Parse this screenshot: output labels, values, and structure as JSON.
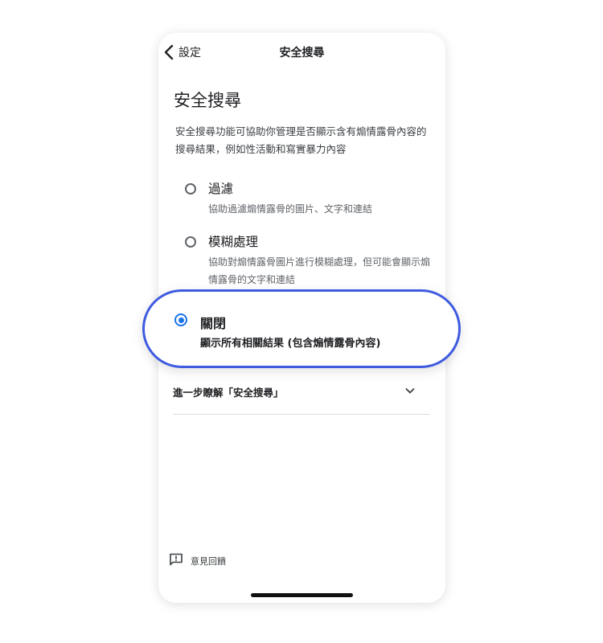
{
  "header": {
    "back_label": "設定",
    "title": "安全搜尋"
  },
  "page": {
    "title": "安全搜尋",
    "description": "安全搜尋功能可協助你管理是否顯示含有煽情露骨內容的搜尋結果，例如性活動和寫實暴力內容"
  },
  "options": [
    {
      "label": "過濾",
      "description": "協助過濾煽情露骨的圖片、文字和連結",
      "selected": false
    },
    {
      "label": "模糊處理",
      "description": "協助對煽情露骨圖片進行模糊處理，但可能會顯示煽情露骨的文字和連結",
      "selected": false
    },
    {
      "label": "關閉",
      "description": "顯示所有相關結果 (包含煽情露骨內容)",
      "selected": true
    }
  ],
  "learn_more": {
    "label": "進一步瞭解「安全搜尋」",
    "icon": "chevron-down-icon"
  },
  "feedback": {
    "label": "意見回饋",
    "icon": "feedback-icon"
  },
  "colors": {
    "accent": "#1a73e8",
    "highlight_border": "#3f5be0",
    "text_primary": "#202124",
    "text_secondary": "#5f6368"
  }
}
